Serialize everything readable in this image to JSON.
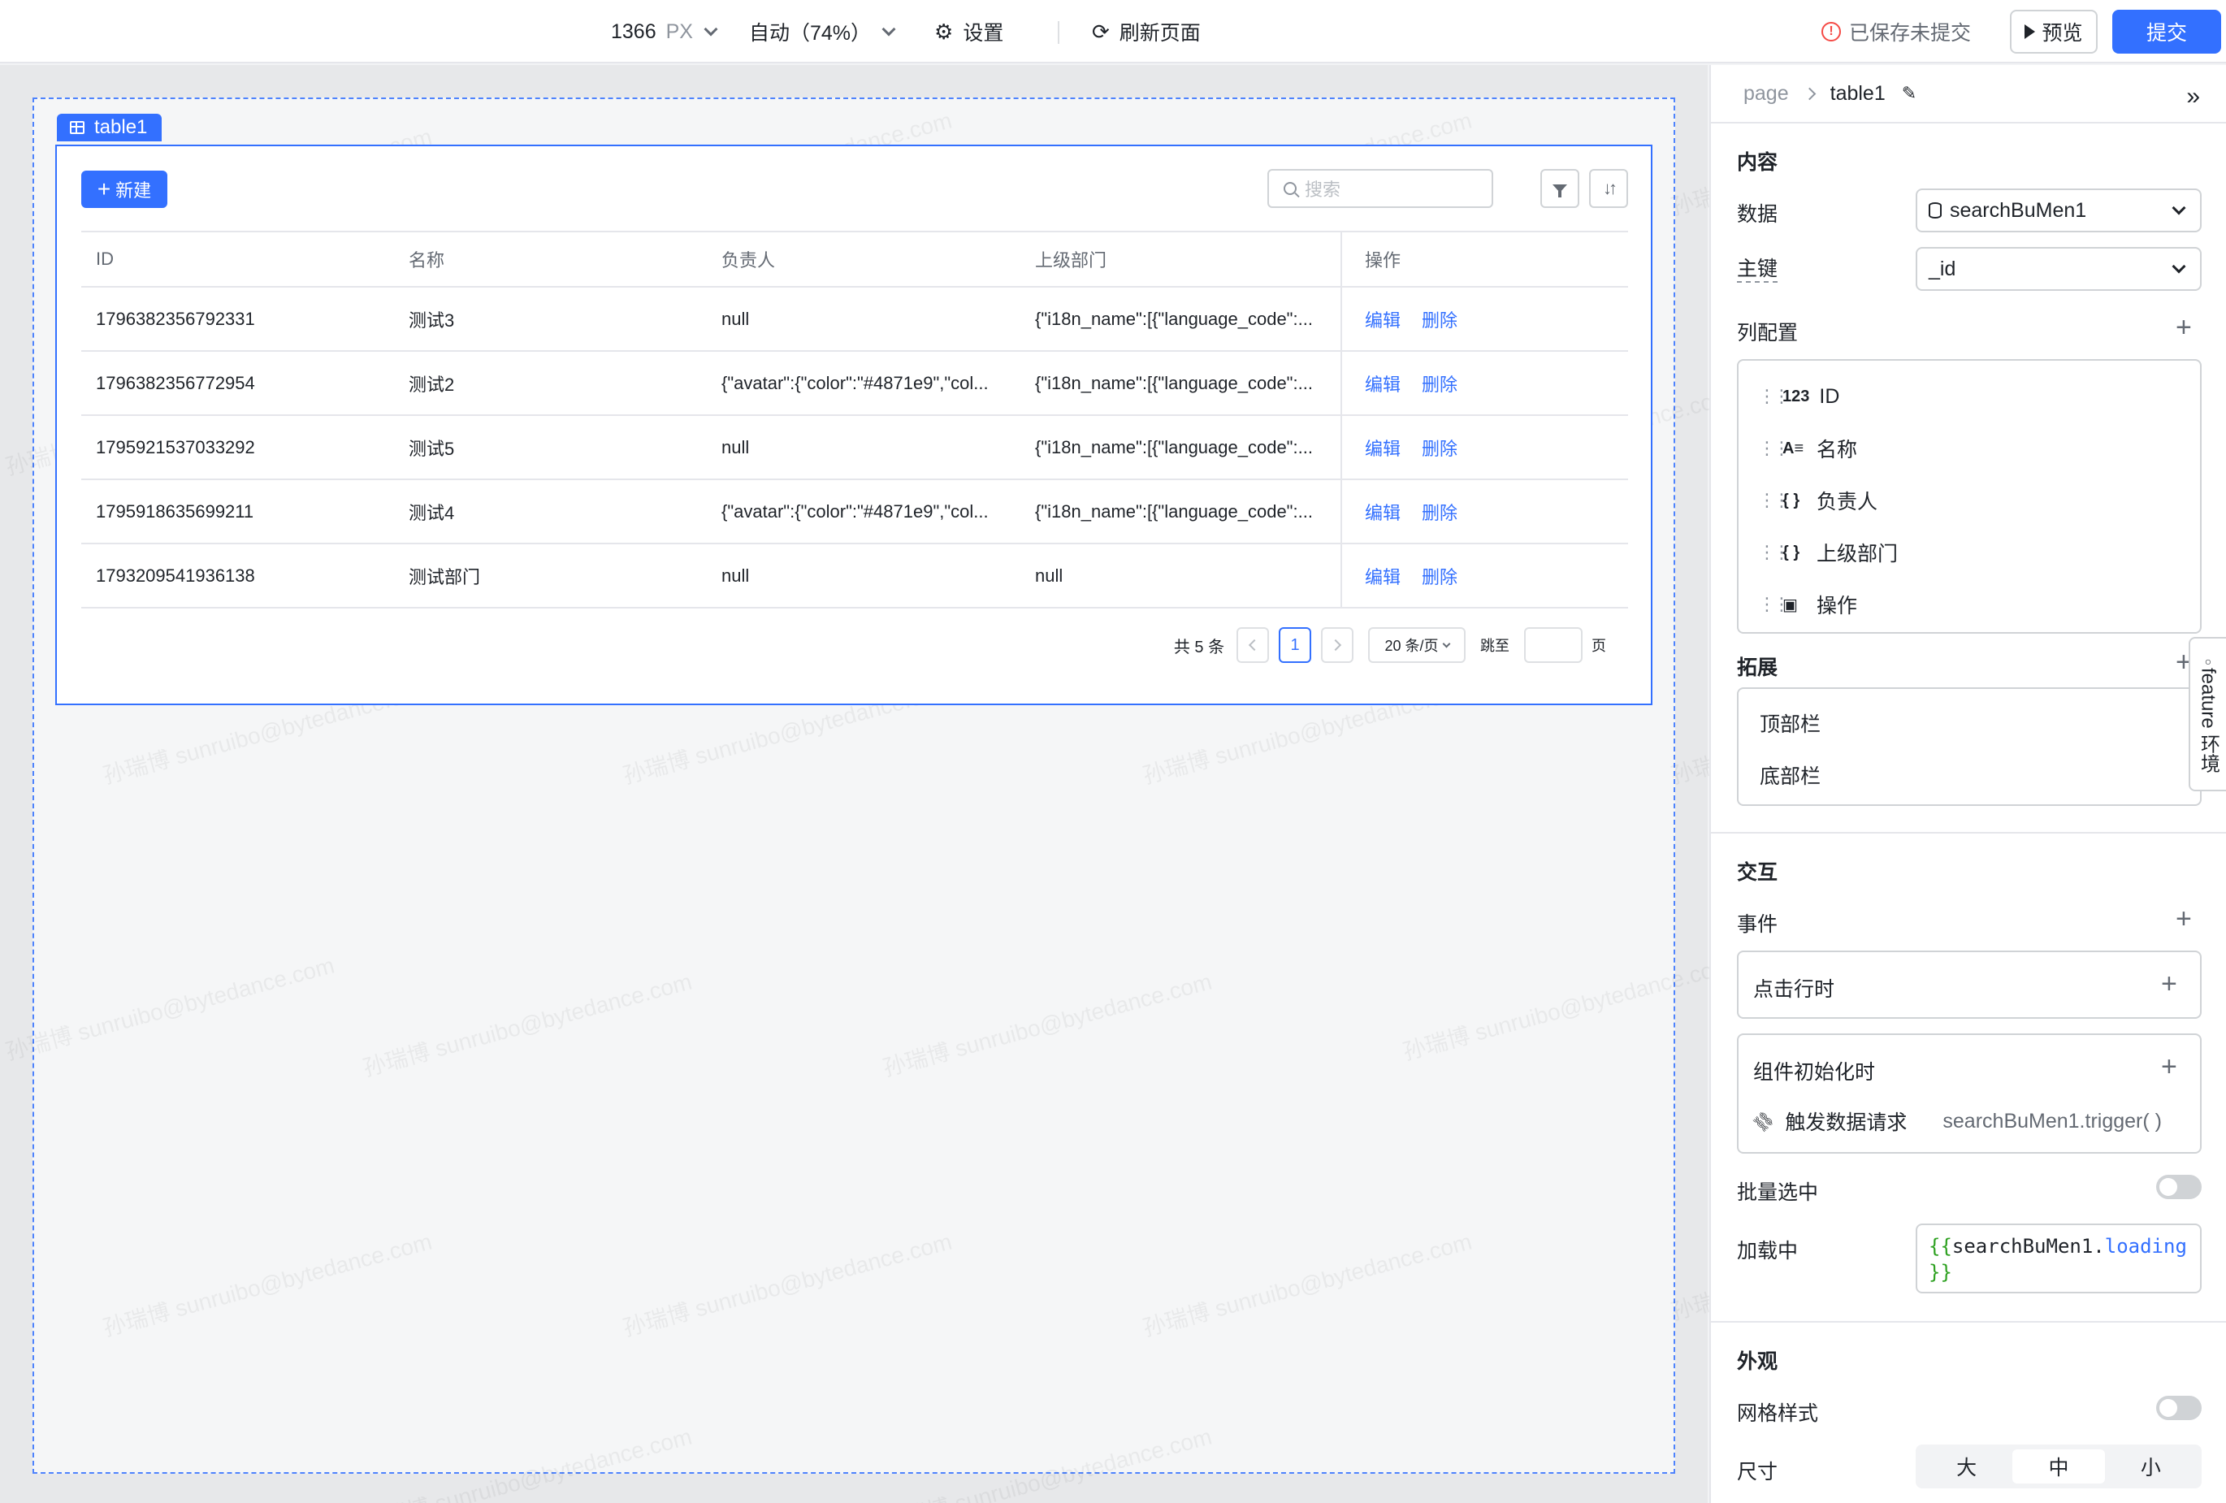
{
  "toolbar": {
    "width_value": "1366",
    "width_unit": "PX",
    "zoom": "自动（74%）",
    "settings": "设置",
    "refresh": "刷新页面",
    "saved_status": "已保存未提交",
    "preview": "预览",
    "submit": "提交"
  },
  "canvas": {
    "component_tag": "table1",
    "new_button": "新建",
    "search_placeholder": "搜索",
    "columns": [
      "ID",
      "名称",
      "负责人",
      "上级部门",
      "操作"
    ],
    "rows": [
      {
        "id": "1796382356792331",
        "name": "测试3",
        "owner": "null",
        "parent": "{\"i18n_name\":[{\"language_code\":..."
      },
      {
        "id": "1796382356772954",
        "name": "测试2",
        "owner": "{\"avatar\":{\"color\":\"#4871e9\",\"col...",
        "parent": "{\"i18n_name\":[{\"language_code\":..."
      },
      {
        "id": "1795921537033292",
        "name": "测试5",
        "owner": "null",
        "parent": "{\"i18n_name\":[{\"language_code\":..."
      },
      {
        "id": "1795918635699211",
        "name": "测试4",
        "owner": "{\"avatar\":{\"color\":\"#4871e9\",\"col...",
        "parent": "{\"i18n_name\":[{\"language_code\":..."
      },
      {
        "id": "1793209541936138",
        "name": "测试部门",
        "owner": "null",
        "parent": "null"
      }
    ],
    "row_actions": {
      "edit": "编辑",
      "delete": "删除"
    },
    "pagination": {
      "total": "共 5 条",
      "current_page": "1",
      "page_size": "20 条/页",
      "jump_label": "跳至",
      "page_suffix": "页"
    },
    "watermark": "孙瑞博 sunruibo@bytedance.com"
  },
  "panel": {
    "breadcrumb_root": "page",
    "component_name": "table1",
    "content_title": "内容",
    "data_label": "数据",
    "data_value": "searchBuMen1",
    "key_label": "主键",
    "key_value": "_id",
    "column_config_label": "列配置",
    "column_items": [
      {
        "type_icon": "123",
        "label": "ID"
      },
      {
        "type_icon": "A≡",
        "label": "名称"
      },
      {
        "type_icon": "{ }",
        "label": "负责人"
      },
      {
        "type_icon": "{ }",
        "label": "上级部门"
      },
      {
        "type_icon": "▣",
        "label": "操作"
      }
    ],
    "extend_title": "拓展",
    "extend_items": [
      "顶部栏",
      "底部栏"
    ],
    "side_tab": "feature 环境",
    "interaction_title": "交互",
    "events_label": "事件",
    "event_row_click": "点击行时",
    "event_init": "组件初始化时",
    "event_init_action": "触发数据请求",
    "event_init_action_value": "searchBuMen1.trigger( )",
    "batch_select_label": "批量选中",
    "batch_select_on": false,
    "loading_label": "加载中",
    "loading_code_open": "{{",
    "loading_code_var": "searchBuMen1.",
    "loading_code_prop": "loading",
    "loading_code_close": "}}",
    "appearance_title": "外观",
    "grid_style_label": "网格样式",
    "grid_style_on": false,
    "size_label": "尺寸",
    "size_options": [
      "大",
      "中",
      "小"
    ],
    "size_selected": "中"
  },
  "colors": {
    "accent": "#3370ff",
    "text": "#1f2329",
    "muted": "#8f959e",
    "warning": "#f54a45",
    "code_bracket": "#2ea121"
  }
}
